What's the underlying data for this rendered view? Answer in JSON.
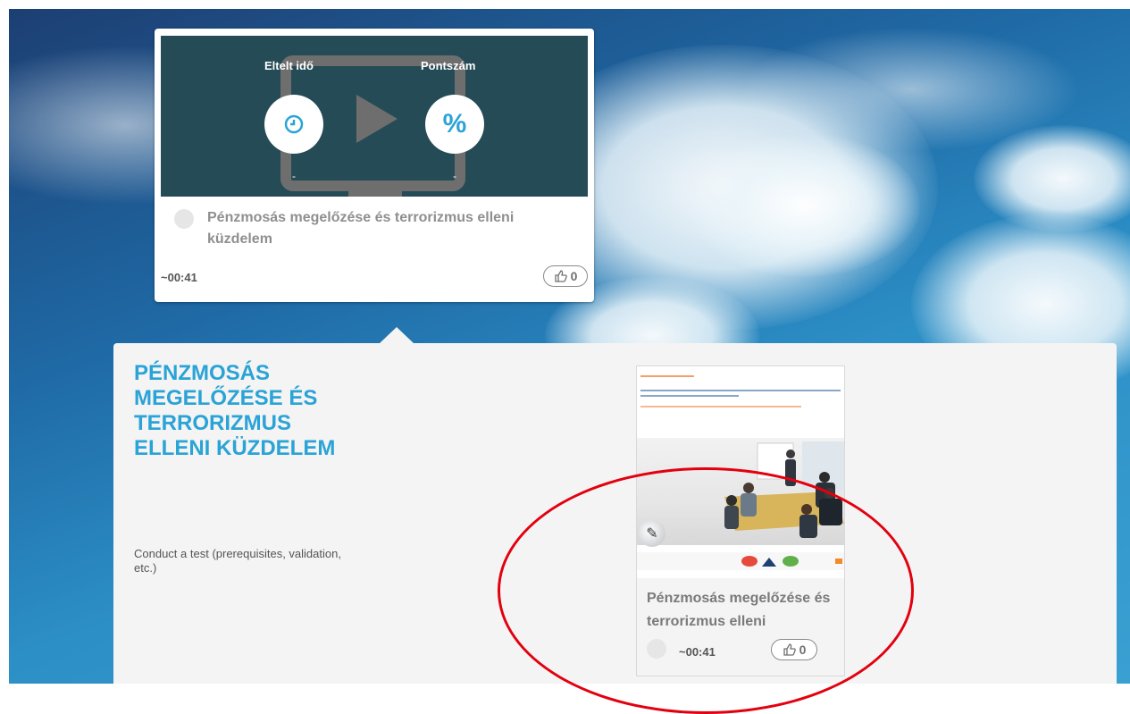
{
  "colors": {
    "accent": "#2aa3d6",
    "thumb_bg": "#244b56",
    "highlight": "#e3000f"
  },
  "top_card": {
    "elapsed_label": "Eltelt idő",
    "score_label": "Pontszám",
    "elapsed_value": "-",
    "score_value": "-",
    "elapsed_icon": "clock-icon",
    "score_icon": "percent-icon",
    "play_icon": "play-icon",
    "title": "Pénzmosás megelőzése és terrorizmus elleni küzdelem",
    "duration": "~00:41",
    "likes": "0"
  },
  "detail": {
    "title": "PÉNZMOSÁS MEGELŐZÉSE ÉS TERRORIZMUS ELLENI KÜZDELEM",
    "subtitle": "Conduct a test (prerequisites, validation, etc.)",
    "activity": {
      "title": "Pénzmosás megelőzése és terrorizmus elleni küzdelem",
      "duration": "~00:41",
      "likes": "0"
    }
  }
}
